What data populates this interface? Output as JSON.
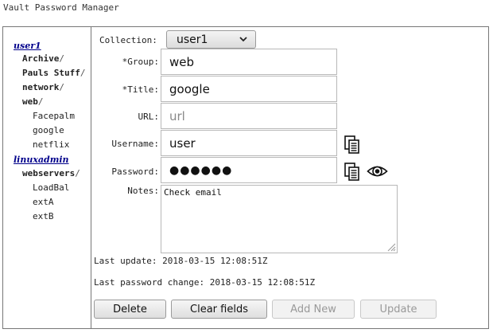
{
  "window": {
    "title": "Vault Password Manager"
  },
  "tree": [
    {
      "kind": "root",
      "label": "user1"
    },
    {
      "kind": "folder",
      "label": "Archive",
      "slash": "/"
    },
    {
      "kind": "folder",
      "label": "Pauls Stuff",
      "slash": "/"
    },
    {
      "kind": "folder",
      "label": "network",
      "slash": "/"
    },
    {
      "kind": "folder",
      "label": "web",
      "slash": "/"
    },
    {
      "kind": "leaf",
      "label": "Facepalm"
    },
    {
      "kind": "leaf",
      "label": "google"
    },
    {
      "kind": "leaf",
      "label": "netflix"
    },
    {
      "kind": "root",
      "label": "linuxadmin"
    },
    {
      "kind": "folder",
      "label": "webservers",
      "slash": "/"
    },
    {
      "kind": "leaf",
      "label": "LoadBal"
    },
    {
      "kind": "leaf",
      "label": "extA"
    },
    {
      "kind": "leaf",
      "label": "extB"
    }
  ],
  "form": {
    "collection_label": "Collection:",
    "collection_value": "user1",
    "group_label": "*Group:",
    "group_value": "web",
    "title_label": "*Title:",
    "title_value": "google",
    "url_label": "URL:",
    "url_placeholder": "url",
    "username_label": "Username:",
    "username_value": "user",
    "password_label": "Password:",
    "password_masked": "●●●●●●",
    "notes_label": "Notes:",
    "notes_value": "Check email"
  },
  "meta": {
    "last_update": "Last update: 2018-03-15 12:08:51Z",
    "last_password_change": "Last password change: 2018-03-15 12:08:51Z"
  },
  "buttons": {
    "delete": "Delete",
    "clear": "Clear fields",
    "add_new": "Add New",
    "update": "Update"
  },
  "icons": {
    "copy": "copy-icon",
    "eye": "eye-icon",
    "chevron": "chevron-down-icon"
  },
  "colors": {
    "root_link": "#00008b",
    "border": "#777777"
  }
}
